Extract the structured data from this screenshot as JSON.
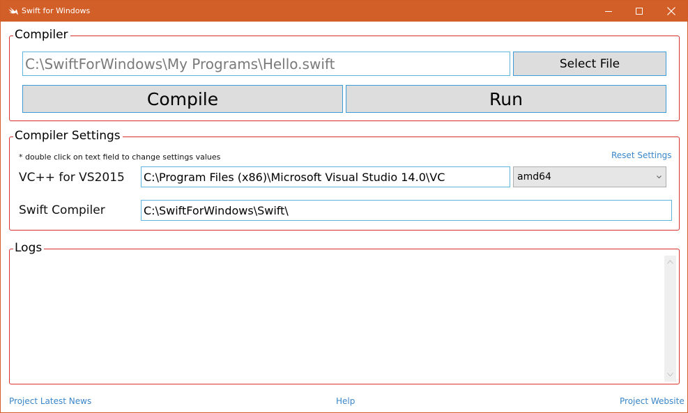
{
  "window": {
    "title": "Swift for Windows",
    "accent_color": "#d35f28"
  },
  "compiler": {
    "legend": "Compiler",
    "file_path": "C:\\SwiftForWindows\\My Programs\\Hello.swift",
    "select_file_label": "Select File",
    "compile_label": "Compile",
    "run_label": "Run"
  },
  "settings": {
    "legend": "Compiler Settings",
    "note": "* double click on text field to change settings values",
    "reset_label": "Reset Settings",
    "vc_label": "VC++ for VS2015",
    "vc_path": "C:\\Program Files (x86)\\Microsoft Visual Studio 14.0\\VC",
    "arch_selected": "amd64",
    "swift_label": "Swift Compiler",
    "swift_path": "C:\\SwiftForWindows\\Swift\\"
  },
  "logs": {
    "legend": "Logs",
    "content": ""
  },
  "footer": {
    "news_label": "Project Latest News",
    "help_label": "Help",
    "website_label": "Project Website"
  }
}
